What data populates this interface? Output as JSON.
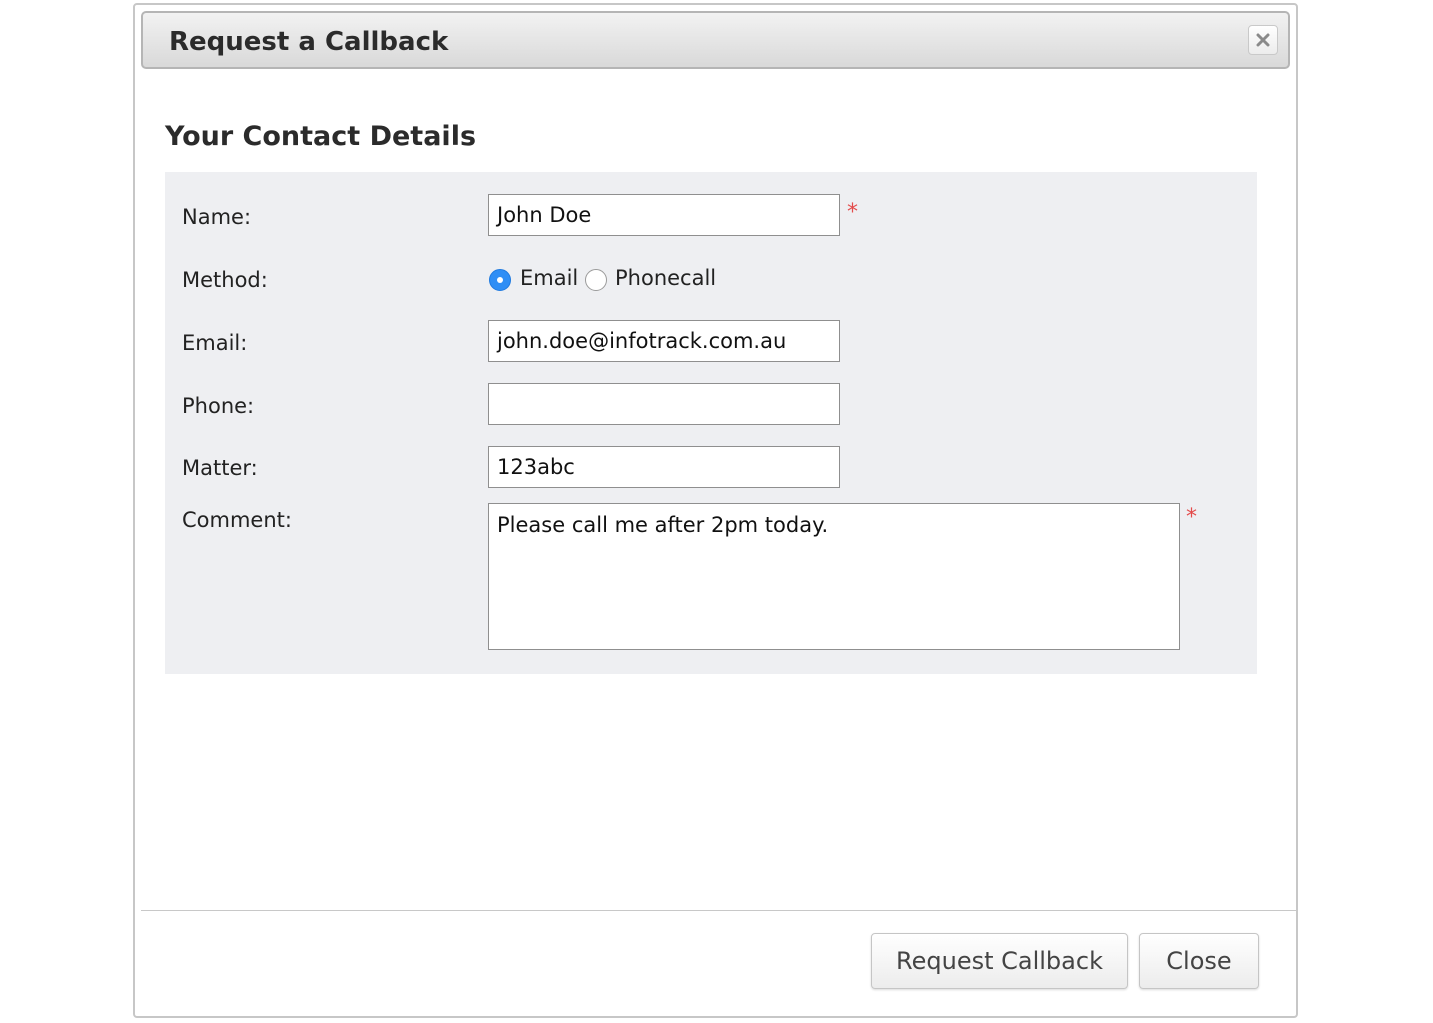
{
  "dialog": {
    "title": "Request a Callback",
    "close_icon": "close-icon"
  },
  "section": {
    "title": "Your Contact Details"
  },
  "form": {
    "name_label": "Name:",
    "name_value": "John Doe",
    "method_label": "Method:",
    "method_options": [
      "Email",
      "Phonecall"
    ],
    "method_selected": "Email",
    "email_label": "Email:",
    "email_value": "john.doe@infotrack.com.au",
    "phone_label": "Phone:",
    "phone_value": "",
    "matter_label": "Matter:",
    "matter_value": "123abc",
    "comment_label": "Comment:",
    "comment_value": "Please call me after 2pm today.",
    "required_marker": "*"
  },
  "footer": {
    "request_button": "Request Callback",
    "close_button": "Close"
  },
  "colors": {
    "accent": "#2f8ef5",
    "required": "#e34b4b",
    "panel_bg": "#eeeff2"
  }
}
